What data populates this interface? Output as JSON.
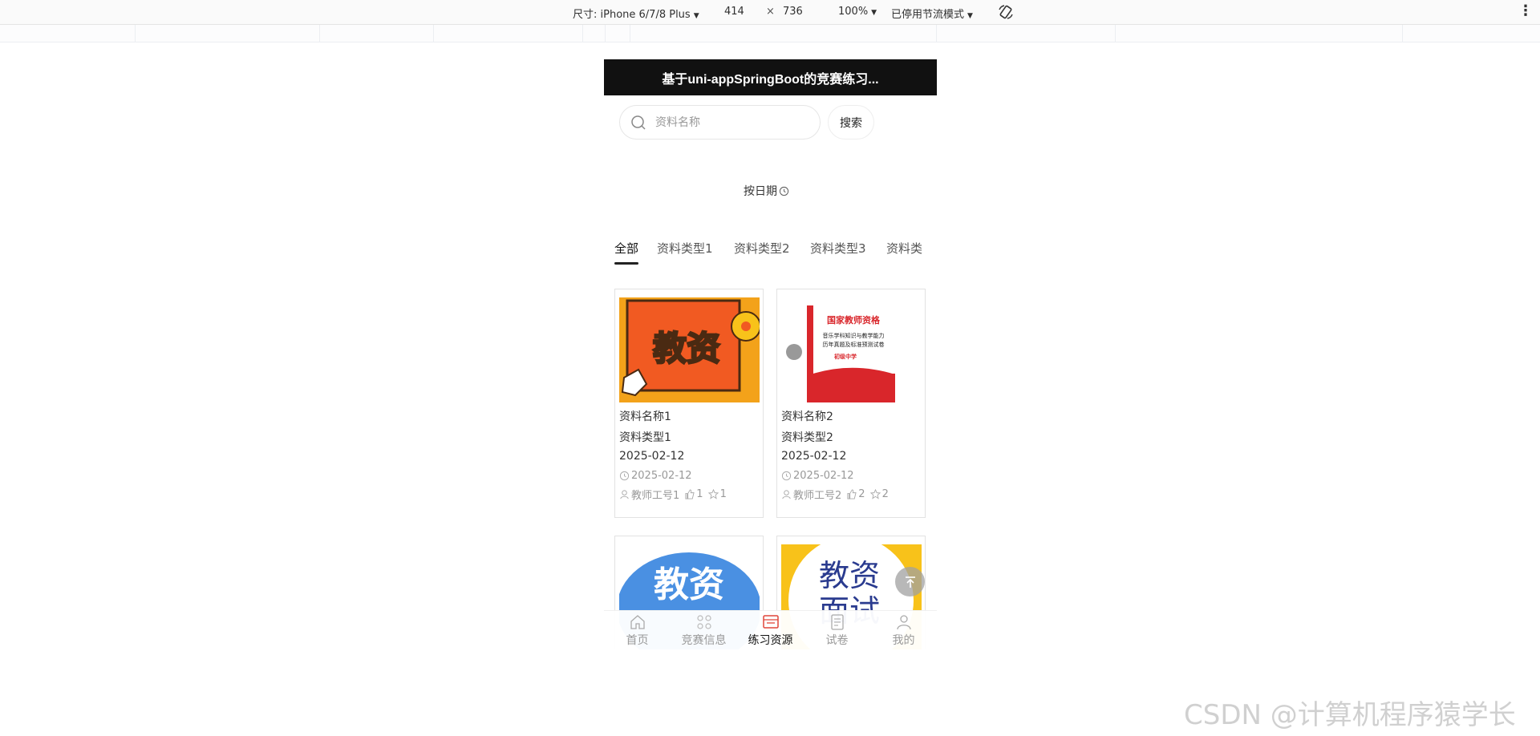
{
  "devtools": {
    "device_label": "尺寸: iPhone 6/7/8 Plus",
    "width": "414",
    "times": "×",
    "height": "736",
    "zoom": "100%",
    "throttle": "已停用节流模式"
  },
  "app": {
    "title": "基于uni-appSpringBoot的竞赛练习...",
    "search": {
      "placeholder": "资料名称",
      "button_label": "搜索"
    },
    "sort_label": "按日期",
    "tabs": [
      {
        "label": "全部",
        "active": true
      },
      {
        "label": "资料类型1"
      },
      {
        "label": "资料类型2"
      },
      {
        "label": "资料类型3"
      },
      {
        "label": "资料类"
      }
    ],
    "cards": [
      {
        "name": "资料名称1",
        "type": "资料类型1",
        "date": "2025-02-12",
        "time": "2025-02-12",
        "teacher": "教师工号1",
        "likes": "1",
        "favs": "1",
        "thumb_text": "教资"
      },
      {
        "name": "资料名称2",
        "type": "资料类型2",
        "date": "2025-02-12",
        "time": "2025-02-12",
        "teacher": "教师工号2",
        "likes": "2",
        "favs": "2",
        "thumb_lines": [
          "国家教师资格",
          "音乐学科知识与教学能力",
          "历年真题及标准预测试卷",
          "初级中学"
        ]
      },
      {
        "thumb_text": "教资"
      },
      {
        "thumb_text": "教资",
        "thumb_text2": "面试"
      }
    ],
    "tabbar": [
      {
        "label": "首页",
        "icon": "home-icon"
      },
      {
        "label": "竞赛信息",
        "icon": "grid-icon"
      },
      {
        "label": "练习资源",
        "icon": "resource-icon",
        "active": true
      },
      {
        "label": "试卷",
        "icon": "exam-icon"
      },
      {
        "label": "我的",
        "icon": "user-icon"
      }
    ]
  },
  "watermark": "CSDN @计算机程序猿学长",
  "colors": {
    "navbar": "#111111",
    "accent_active": "#e0463a"
  }
}
